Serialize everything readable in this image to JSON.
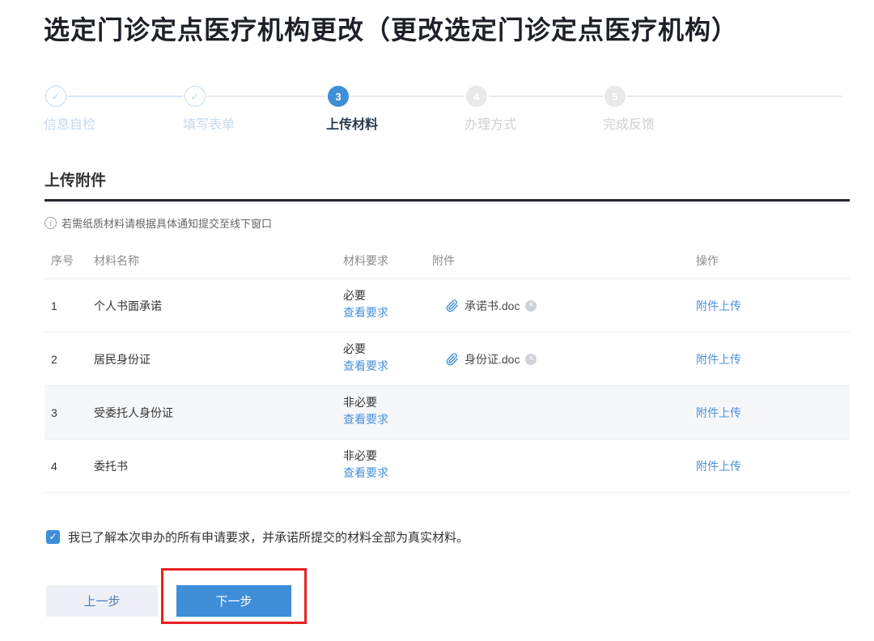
{
  "page": {
    "title": "选定门诊定点医疗机构更改（更改选定门诊定点医疗机构）"
  },
  "stepper": {
    "steps": [
      {
        "num": "1",
        "label": "信息自检",
        "state": "done"
      },
      {
        "num": "2",
        "label": "填写表单",
        "state": "done"
      },
      {
        "num": "3",
        "label": "上传材料",
        "state": "active"
      },
      {
        "num": "4",
        "label": "办理方式",
        "state": "pending"
      },
      {
        "num": "5",
        "label": "完成反馈",
        "state": "pending"
      }
    ]
  },
  "section": {
    "heading": "上传附件",
    "notice": "若需纸质材料请根据具体通知提交至线下窗口"
  },
  "table": {
    "headers": {
      "no": "序号",
      "name": "材料名称",
      "requirement": "材料要求",
      "attachment": "附件",
      "action": "操作"
    },
    "rows": [
      {
        "no": "1",
        "name": "个人书面承诺",
        "requirement": "必要",
        "view_link": "查看要求",
        "attachment": "承诺书.doc",
        "action": "附件上传"
      },
      {
        "no": "2",
        "name": "居民身份证",
        "requirement": "必要",
        "view_link": "查看要求",
        "attachment": "身份证.doc",
        "action": "附件上传"
      },
      {
        "no": "3",
        "name": "受委托人身份证",
        "requirement": "非必要",
        "view_link": "查看要求",
        "attachment": "",
        "action": "附件上传"
      },
      {
        "no": "4",
        "name": "委托书",
        "requirement": "非必要",
        "view_link": "查看要求",
        "attachment": "",
        "action": "附件上传"
      }
    ]
  },
  "agreement": {
    "checked": true,
    "text": "我已了解本次申办的所有申请要求，并承诺所提交的材料全部为真实材料。"
  },
  "actions": {
    "prev": "上一步",
    "next": "下一步"
  },
  "icons": {
    "check": "✓",
    "close": "×",
    "info": "i"
  },
  "colors": {
    "primary_blue": "#3e8ed8",
    "link_blue": "#4a90d9",
    "highlight_red": "#e62222"
  }
}
